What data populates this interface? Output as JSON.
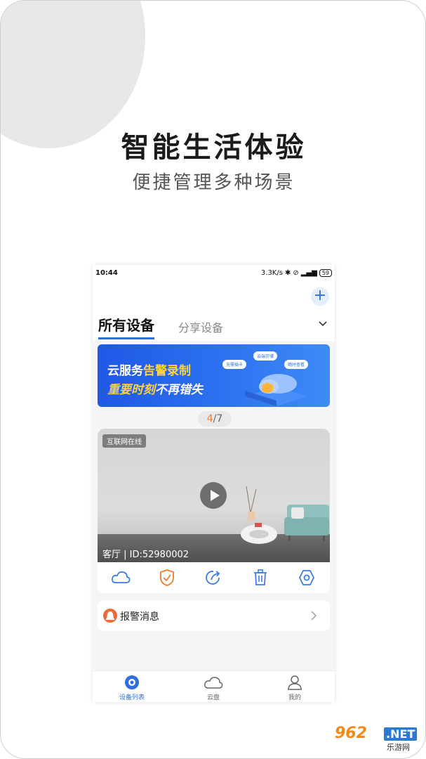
{
  "promo": {
    "headline": "智能生活体验",
    "subline": "便捷管理多种场景"
  },
  "status_bar": {
    "time": "10:44",
    "network_speed": "3.3K/s",
    "battery": "59"
  },
  "header": {
    "add_icon": "plus-icon",
    "tabs": [
      {
        "label": "所有设备",
        "active": true
      },
      {
        "label": "分享设备",
        "active": false
      }
    ]
  },
  "banner": {
    "line1_prefix": "云服务",
    "line1_highlight": "告警录制",
    "line2_highlight": "重要时刻",
    "line2_suffix": "不再错失",
    "pills": [
      "无需插卡",
      "云端存储",
      "随时查看"
    ]
  },
  "pager": {
    "current": "4",
    "separator": "/",
    "total": "7"
  },
  "device_card": {
    "status_tag": "互联网在线",
    "label": "客厅 | ID:52980002",
    "toolbar": [
      {
        "name": "cloud-icon"
      },
      {
        "name": "shield-icon"
      },
      {
        "name": "share-icon"
      },
      {
        "name": "trash-icon"
      },
      {
        "name": "settings-icon"
      }
    ]
  },
  "alarm": {
    "label": "报警消息"
  },
  "bottom_nav": [
    {
      "label": "设备列表",
      "icon": "device-list-icon",
      "active": true
    },
    {
      "label": "云盘",
      "icon": "cloud-icon",
      "active": false
    },
    {
      "label": "我的",
      "icon": "profile-icon",
      "active": false
    }
  ],
  "watermark": {
    "logo": "962",
    "domain": ".NET",
    "name": "乐游网"
  },
  "colors": {
    "accent": "#2f6fe0",
    "warning": "#f07a2a",
    "banner_highlight": "#ffd33d"
  }
}
